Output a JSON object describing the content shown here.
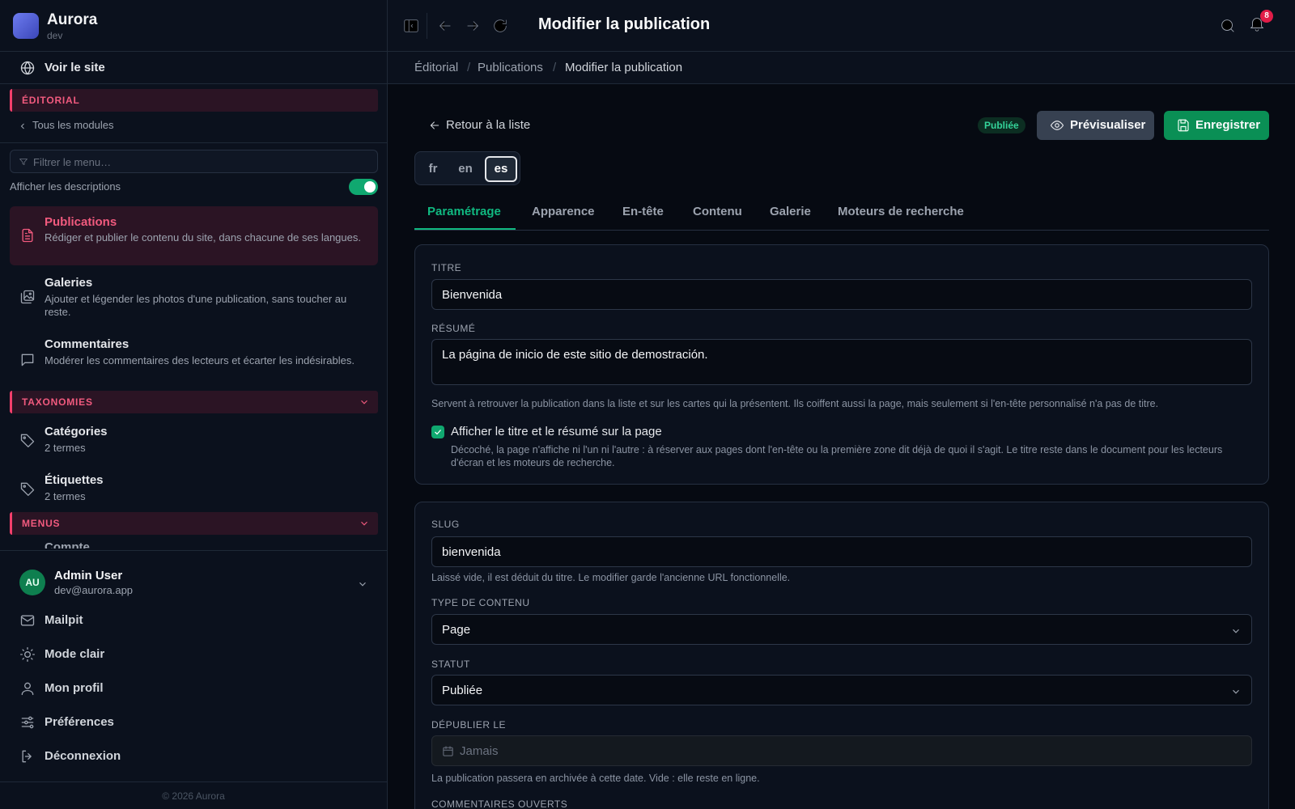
{
  "sidebar": {
    "brand_name": "Aurora",
    "brand_env": "dev",
    "view_site": "Voir le site",
    "section_editorial": "ÉDITORIAL",
    "all_modules": "Tous les modules",
    "filter_placeholder": "Filtrer le menu…",
    "show_descriptions": "Afficher les descriptions",
    "show_descriptions_on": true,
    "items": [
      {
        "title": "Publications",
        "desc": "Rédiger et publier le contenu du site, dans chacune de ses langues."
      },
      {
        "title": "Galeries",
        "desc": "Ajouter et légender les photos d'une publication, sans toucher au reste."
      },
      {
        "title": "Commentaires",
        "desc": "Modérer les commentaires des lecteurs et écarter les indésirables."
      }
    ],
    "section_taxonomies": "TAXONOMIES",
    "taxonomies": [
      {
        "title": "Catégories",
        "desc": "2 termes"
      },
      {
        "title": "Étiquettes",
        "desc": "2 termes"
      }
    ],
    "section_menus": "MENUS",
    "cut_item": "Compte",
    "user": {
      "initials": "AU",
      "name": "Admin User",
      "email": "dev@aurora.app"
    },
    "links": [
      "Mailpit",
      "Mode clair",
      "Mon profil",
      "Préférences",
      "Déconnexion"
    ],
    "footer": "© 2026 Aurora"
  },
  "topbar": {
    "title": "Modifier la publication",
    "notif_count": "8"
  },
  "breadcrumb": [
    "Éditorial",
    "Publications",
    "Modifier la publication"
  ],
  "main": {
    "back": "Retour à la liste",
    "status": "Publiée",
    "preview": "Prévisualiser",
    "save": "Enregistrer",
    "langs": [
      "fr",
      "en",
      "es"
    ],
    "active_lang": "es",
    "tabs": [
      "Paramétrage",
      "Apparence",
      "En-tête",
      "Contenu",
      "Galerie",
      "Moteurs de recherche"
    ],
    "card1": {
      "title_label": "TITRE",
      "title_value": "Bienvenida",
      "summary_label": "RÉSUMÉ",
      "summary_value": "La página de inicio de este sitio de demostración.",
      "summary_help": "Servent à retrouver la publication dans la liste et sur les cartes qui la présentent. Ils coiffent aussi la page, mais seulement si l'en-tête personnalisé n'a pas de titre.",
      "show_title_label": "Afficher le titre et le résumé sur la page",
      "show_title_checked": true,
      "show_title_help": "Décoché, la page n'affiche ni l'un ni l'autre : à réserver aux pages dont l'en-tête ou la première zone dit déjà de quoi il s'agit. Le titre reste dans le document pour les lecteurs d'écran et les moteurs de recherche."
    },
    "card2": {
      "slug_label": "SLUG",
      "slug_value": "bienvenida",
      "slug_help": "Laissé vide, il est déduit du titre. Le modifier garde l'ancienne URL fonctionnelle.",
      "type_label": "TYPE DE CONTENU",
      "type_value": "Page",
      "status_label": "STATUT",
      "status_value": "Publiée",
      "unpublish_label": "DÉPUBLIER LE",
      "unpublish_placeholder": "Jamais",
      "unpublish_help": "La publication passera en archivée à cette date. Vide : elle reste en ligne.",
      "comments_label": "COMMENTAIRES OUVERTS"
    }
  },
  "colors": {
    "accent_pink": "#f15a7e",
    "accent_green": "#10b981",
    "save_green": "#0a8f55"
  }
}
